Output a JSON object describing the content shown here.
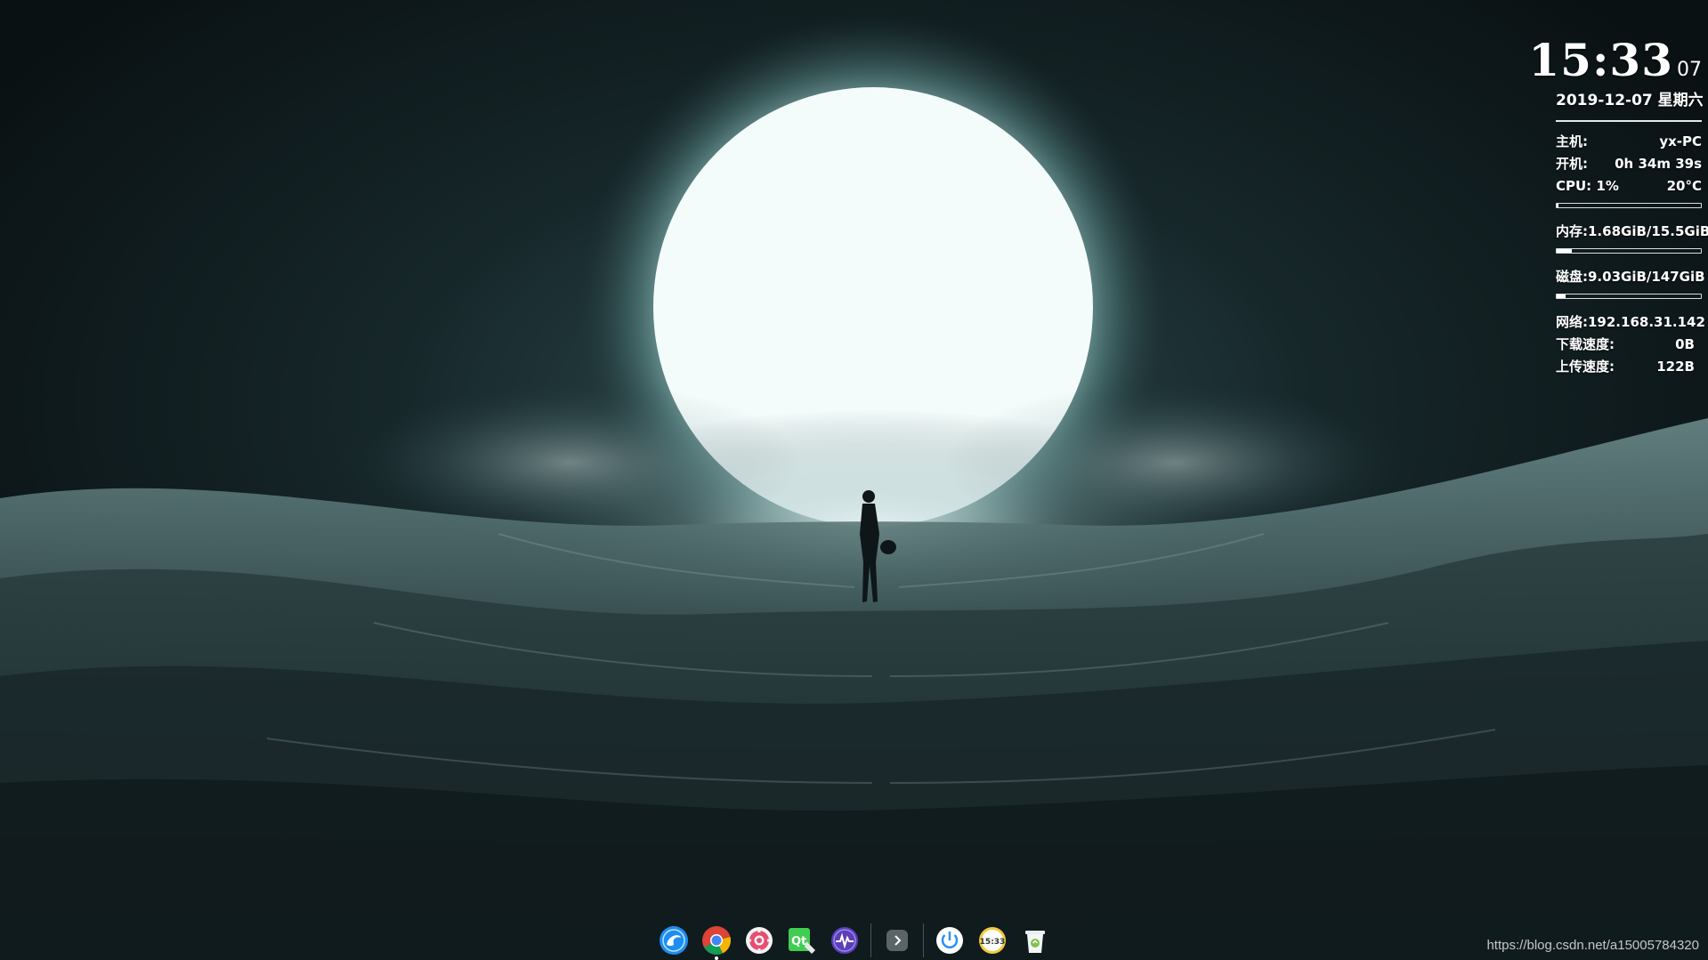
{
  "clock": {
    "time": "15:33",
    "seconds": "07",
    "date": "2019-12-07 星期六"
  },
  "system": {
    "host_label": "主机:",
    "host_value": "yx-PC",
    "uptime_label": "开机:",
    "uptime_value": "0h 34m 39s",
    "cpu_label": "CPU: 1%",
    "cpu_temp": "20°C",
    "cpu_percent": 1,
    "memory_label": "内存:",
    "memory_value": "1.68GiB/15.5GiB",
    "memory_fraction": 0.108,
    "disk_label": "磁盘:",
    "disk_value": "9.03GiB/147GiB",
    "disk_fraction": 0.061,
    "network_label": "网络:",
    "network_value": "192.168.31.142",
    "download_label": "下载速度:",
    "download_value": "0B",
    "upload_label": "上传速度:",
    "upload_value": "122B"
  },
  "dock": {
    "items": [
      {
        "name": "launcher-icon",
        "active": false
      },
      {
        "name": "chrome-icon",
        "active": true
      },
      {
        "name": "settings-icon",
        "active": false
      },
      {
        "name": "qt-creator-icon",
        "active": false
      },
      {
        "name": "system-monitor-icon",
        "active": false
      },
      {
        "name": "expand-tray-icon",
        "active": false
      },
      {
        "name": "power-icon",
        "active": false
      },
      {
        "name": "clock-icon",
        "active": false,
        "text": "15:33"
      },
      {
        "name": "trash-icon",
        "active": false
      }
    ]
  },
  "watermark": "https://blog.csdn.net/a15005784320",
  "colors": {
    "background": "#0c1416",
    "moon": "#f4fbfb",
    "glow": "#7fb8b4",
    "text": "#ffffff"
  }
}
